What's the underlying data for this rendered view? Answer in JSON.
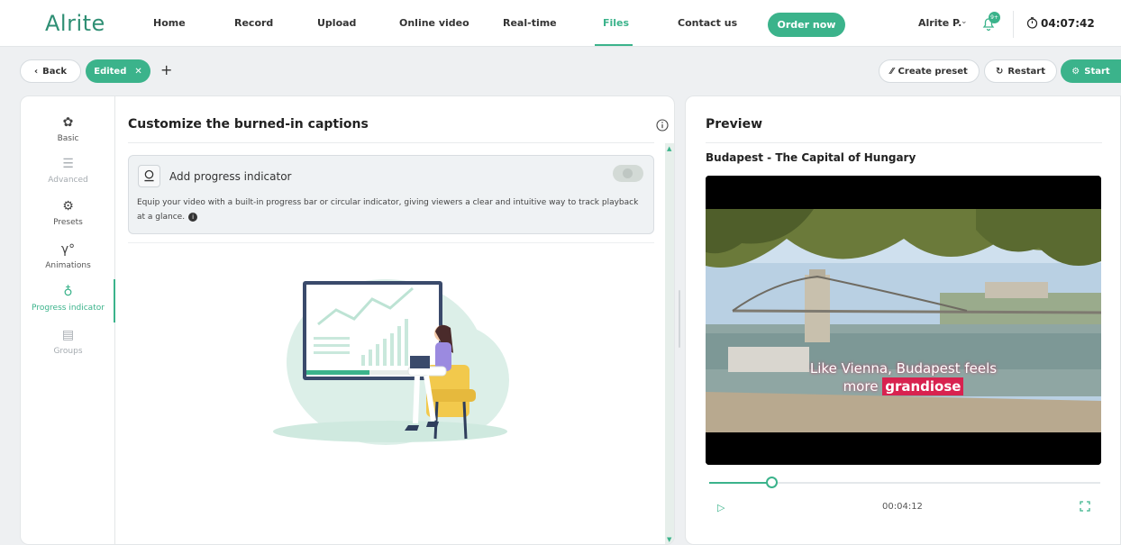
{
  "app": {
    "logo": "Alrite"
  },
  "nav": {
    "items": [
      "Home",
      "Record",
      "Upload",
      "Online video",
      "Real-time",
      "Files",
      "Contact us"
    ],
    "active": "Files",
    "order_label": "Order now"
  },
  "user": {
    "name": "Alrite P.",
    "notifications_badge": "9+"
  },
  "timer": {
    "value": "04:07:42"
  },
  "toolbar": {
    "back_label": "Back",
    "tab_label": "Edited",
    "create_preset_label": "Create preset",
    "restart_label": "Restart",
    "start_label": "Start"
  },
  "sidebar": {
    "items": [
      {
        "label": "Basic",
        "icon": "palette-icon",
        "state": "normal"
      },
      {
        "label": "Advanced",
        "icon": "sliders-icon",
        "state": "dim"
      },
      {
        "label": "Presets",
        "icon": "cog-badge-icon",
        "state": "normal"
      },
      {
        "label": "Animations",
        "icon": "animation-icon",
        "state": "normal"
      },
      {
        "label": "Progress indicator",
        "icon": "progress-indicator-icon",
        "state": "active"
      },
      {
        "label": "Groups",
        "icon": "groups-icon",
        "state": "dim"
      }
    ]
  },
  "editor": {
    "title": "Customize the burned-in captions",
    "card": {
      "label": "Add progress indicator",
      "enabled": false,
      "description": "Equip your video with a built-in progress bar or circular indicator, giving viewers a clear and intuitive way to track playback at a glance."
    }
  },
  "preview": {
    "title": "Preview",
    "video_title": "Budapest - The Capital of Hungary",
    "caption_line1": "Like Vienna, Budapest feels",
    "caption_line2_prefix": "more",
    "caption_line2_highlight": "grandiose",
    "time": "00:04:12",
    "progress_fraction": 0.16
  },
  "colors": {
    "accent": "#3bb38b",
    "caption_highlight": "#d8224f"
  }
}
